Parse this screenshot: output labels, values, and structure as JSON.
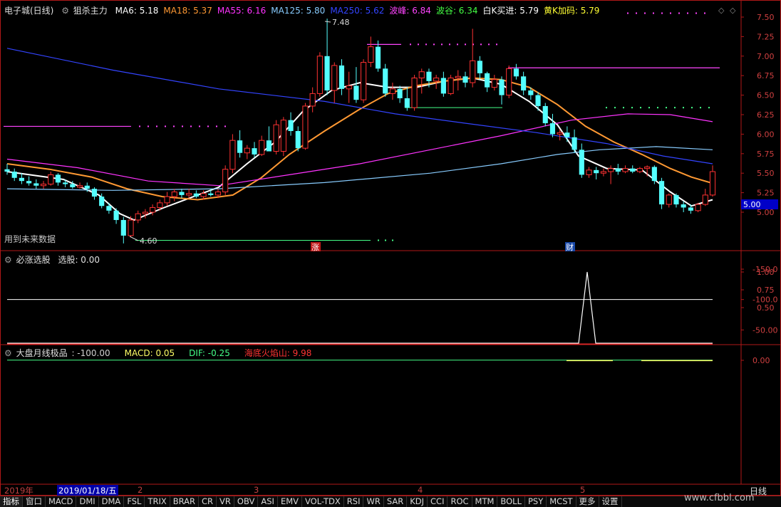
{
  "main_header": {
    "stock": "电子城(日线)",
    "indicator": "狙杀主力",
    "items": [
      {
        "label": "MA6: 5.18",
        "color": "#ffffff"
      },
      {
        "label": "MA18: 5.37",
        "color": "#ff9933"
      },
      {
        "label": "MA55: 6.16",
        "color": "#ff33ff"
      },
      {
        "label": "MA125: 5.80",
        "color": "#88ccff"
      },
      {
        "label": "MA250: 5.62",
        "color": "#3344ff"
      },
      {
        "label": "波峰: 6.84",
        "color": "#ff44ff"
      },
      {
        "label": "波谷: 6.34",
        "color": "#44ff44"
      },
      {
        "label": "白K买进: 5.79",
        "color": "#ffffff"
      },
      {
        "label": "黄K加码: 5.79",
        "color": "#ffff33"
      }
    ]
  },
  "panel2_header": {
    "title": "必涨选股",
    "value": "选股: 0.00"
  },
  "panel3_header": {
    "title": "大盘月线极品",
    "items": [
      {
        "label": ": -100.00",
        "color": "#d0d0d0"
      },
      {
        "label": "MACD: 0.05",
        "color": "#ffff66"
      },
      {
        "label": "DIF: -0.25",
        "color": "#44ff88"
      },
      {
        "label": "海底火焰山: 9.98",
        "color": "#ff3333"
      }
    ]
  },
  "annotations": {
    "future_data": "用到未来数据",
    "high_label": "7.48",
    "low_label": "4.60",
    "marker_zhang": "涨",
    "marker_cai": "财",
    "current_price": "5.00"
  },
  "date_bar": {
    "year": "2019年",
    "selected": "2019/01/18/五",
    "months": [
      "2",
      "3",
      "4",
      "5"
    ],
    "period": "日线"
  },
  "tabs": [
    "指标",
    "窗口",
    "MACD",
    "DMI",
    "DMA",
    "FSL",
    "TRIX",
    "BRAR",
    "CR",
    "VR",
    "OBV",
    "ASI",
    "EMV",
    "VOL-TDX",
    "RSI",
    "WR",
    "SAR",
    "KDJ",
    "CCI",
    "ROC",
    "MTM",
    "BOLL",
    "PSY",
    "MCST",
    "更多",
    "设置"
  ],
  "watermark": "www.cfbbl.com",
  "colors": {
    "up": "#ff3232",
    "down": "#54ffff",
    "frame": "#b01818"
  },
  "chart_data": [
    {
      "type": "candlestick",
      "title": "电子城(日线)",
      "ylim": [
        4.8,
        7.6
      ],
      "yticks": [
        7.5,
        7.25,
        7.0,
        6.75,
        6.5,
        6.25,
        6.0,
        5.75,
        5.5,
        5.25,
        5.0
      ],
      "ohlc": [
        [
          5.55,
          5.62,
          5.48,
          5.52
        ],
        [
          5.52,
          5.56,
          5.4,
          5.44
        ],
        [
          5.44,
          5.5,
          5.36,
          5.4
        ],
        [
          5.4,
          5.46,
          5.34,
          5.37
        ],
        [
          5.37,
          5.42,
          5.3,
          5.34
        ],
        [
          5.34,
          5.4,
          5.3,
          5.36
        ],
        [
          5.36,
          5.52,
          5.34,
          5.48
        ],
        [
          5.48,
          5.5,
          5.34,
          5.38
        ],
        [
          5.38,
          5.42,
          5.32,
          5.36
        ],
        [
          5.36,
          5.4,
          5.3,
          5.32
        ],
        [
          5.32,
          5.38,
          5.3,
          5.34
        ],
        [
          5.34,
          5.38,
          5.26,
          5.3
        ],
        [
          5.3,
          5.32,
          5.16,
          5.2
        ],
        [
          5.2,
          5.24,
          5.05,
          5.08
        ],
        [
          5.08,
          5.12,
          4.98,
          5.02
        ],
        [
          5.02,
          5.05,
          4.85,
          4.9
        ],
        [
          4.9,
          4.94,
          4.6,
          4.7
        ],
        [
          4.7,
          4.95,
          4.68,
          4.9
        ],
        [
          4.9,
          5.02,
          4.86,
          4.98
        ],
        [
          4.98,
          5.04,
          4.92,
          5.0
        ],
        [
          5.0,
          5.1,
          4.96,
          5.06
        ],
        [
          5.06,
          5.16,
          5.02,
          5.12
        ],
        [
          5.12,
          5.26,
          5.08,
          5.2
        ],
        [
          5.2,
          5.3,
          5.14,
          5.26
        ],
        [
          5.26,
          5.3,
          5.18,
          5.22
        ],
        [
          5.22,
          5.3,
          5.18,
          5.24
        ],
        [
          5.24,
          5.28,
          5.18,
          5.2
        ],
        [
          5.2,
          5.28,
          5.16,
          5.24
        ],
        [
          5.24,
          5.3,
          5.2,
          5.22
        ],
        [
          5.22,
          5.3,
          5.18,
          5.26
        ],
        [
          5.26,
          5.6,
          5.22,
          5.55
        ],
        [
          5.55,
          6.0,
          5.5,
          5.92
        ],
        [
          5.92,
          6.05,
          5.7,
          5.76
        ],
        [
          5.76,
          5.86,
          5.68,
          5.82
        ],
        [
          5.82,
          5.9,
          5.7,
          5.74
        ],
        [
          5.74,
          5.98,
          5.72,
          5.92
        ],
        [
          5.92,
          6.1,
          5.8,
          5.78
        ],
        [
          5.78,
          6.18,
          5.74,
          6.12
        ],
        [
          5.78,
          6.22,
          5.72,
          6.18
        ],
        [
          6.18,
          6.28,
          5.98,
          6.04
        ],
        [
          6.04,
          6.1,
          5.78,
          5.82
        ],
        [
          5.82,
          6.4,
          5.8,
          6.36
        ],
        [
          6.36,
          6.6,
          6.28,
          6.52
        ],
        [
          6.52,
          7.05,
          6.48,
          7.0
        ],
        [
          7.0,
          7.48,
          6.5,
          6.56
        ],
        [
          6.56,
          6.92,
          6.4,
          6.88
        ],
        [
          6.88,
          6.96,
          6.5,
          6.58
        ],
        [
          6.58,
          6.8,
          6.4,
          6.62
        ],
        [
          6.62,
          6.86,
          6.4,
          6.44
        ],
        [
          6.44,
          6.96,
          6.4,
          6.92
        ],
        [
          6.92,
          7.25,
          6.86,
          7.12
        ],
        [
          7.12,
          7.2,
          6.8,
          6.84
        ],
        [
          6.84,
          6.9,
          6.48,
          6.52
        ],
        [
          6.52,
          6.66,
          6.44,
          6.58
        ],
        [
          6.58,
          6.62,
          6.4,
          6.46
        ],
        [
          6.46,
          6.6,
          6.3,
          6.34
        ],
        [
          6.34,
          6.76,
          6.3,
          6.72
        ],
        [
          6.72,
          6.84,
          6.52,
          6.8
        ],
        [
          6.8,
          6.84,
          6.6,
          6.68
        ],
        [
          6.68,
          6.76,
          6.58,
          6.72
        ],
        [
          6.72,
          6.8,
          6.48,
          6.52
        ],
        [
          6.52,
          6.76,
          6.5,
          6.72
        ],
        [
          6.72,
          6.82,
          6.56,
          6.74
        ],
        [
          6.74,
          6.8,
          6.6,
          6.66
        ],
        [
          6.66,
          7.35,
          6.6,
          6.94
        ],
        [
          6.94,
          7.0,
          6.7,
          6.78
        ],
        [
          6.78,
          6.8,
          6.54,
          6.6
        ],
        [
          6.6,
          6.76,
          6.56,
          6.7
        ],
        [
          6.7,
          6.74,
          6.38,
          6.5
        ],
        [
          6.5,
          6.88,
          6.46,
          6.84
        ],
        [
          6.84,
          6.9,
          6.7,
          6.74
        ],
        [
          6.74,
          6.8,
          6.5,
          6.56
        ],
        [
          6.56,
          6.6,
          6.44,
          6.5
        ],
        [
          6.5,
          6.54,
          6.3,
          6.36
        ],
        [
          6.36,
          6.4,
          6.1,
          6.14
        ],
        [
          6.14,
          6.26,
          5.96,
          6.0
        ],
        [
          6.0,
          6.06,
          5.92,
          6.02
        ],
        [
          6.02,
          6.1,
          5.9,
          5.96
        ],
        [
          5.96,
          6.06,
          5.76,
          5.8
        ],
        [
          5.8,
          5.88,
          5.44,
          5.48
        ],
        [
          5.48,
          5.58,
          5.44,
          5.54
        ],
        [
          5.54,
          5.58,
          5.42,
          5.5
        ],
        [
          5.5,
          5.56,
          5.46,
          5.52
        ],
        [
          5.52,
          5.6,
          5.36,
          5.56
        ],
        [
          5.56,
          5.62,
          5.48,
          5.52
        ],
        [
          5.52,
          5.6,
          5.5,
          5.56
        ],
        [
          5.56,
          5.6,
          5.5,
          5.52
        ],
        [
          5.52,
          5.58,
          5.5,
          5.56
        ],
        [
          5.56,
          5.6,
          5.46,
          5.58
        ],
        [
          5.58,
          5.6,
          5.36,
          5.4
        ],
        [
          5.4,
          5.44,
          5.04,
          5.1
        ],
        [
          5.1,
          5.24,
          5.06,
          5.22
        ],
        [
          5.22,
          5.24,
          5.06,
          5.1
        ],
        [
          5.1,
          5.14,
          5.0,
          5.06
        ],
        [
          5.06,
          5.1,
          4.98,
          5.02
        ],
        [
          5.02,
          5.12,
          5.0,
          5.1
        ],
        [
          5.1,
          5.3,
          5.08,
          5.22
        ],
        [
          5.22,
          5.6,
          5.2,
          5.52
        ]
      ],
      "ma_series": [
        {
          "name": "MA6",
          "color": "#ffffff",
          "points": [
            [
              0,
              5.52
            ],
            [
              8,
              5.42
            ],
            [
              13,
              5.22
            ],
            [
              16,
              4.98
            ],
            [
              18,
              4.9
            ],
            [
              22,
              5.05
            ],
            [
              27,
              5.22
            ],
            [
              30,
              5.32
            ],
            [
              34,
              5.62
            ],
            [
              38,
              5.9
            ],
            [
              42,
              6.3
            ],
            [
              46,
              6.56
            ],
            [
              50,
              6.66
            ],
            [
              54,
              6.6
            ],
            [
              58,
              6.6
            ],
            [
              62,
              6.68
            ],
            [
              66,
              6.72
            ],
            [
              70,
              6.64
            ],
            [
              74,
              6.42
            ],
            [
              78,
              6.12
            ],
            [
              81,
              5.72
            ],
            [
              85,
              5.56
            ],
            [
              90,
              5.54
            ],
            [
              94,
              5.26
            ],
            [
              97,
              5.08
            ],
            [
              100,
              5.16
            ]
          ]
        },
        {
          "name": "MA18",
          "color": "#ff9933",
          "points": [
            [
              0,
              5.62
            ],
            [
              6,
              5.55
            ],
            [
              12,
              5.45
            ],
            [
              17,
              5.3
            ],
            [
              22,
              5.2
            ],
            [
              27,
              5.16
            ],
            [
              32,
              5.22
            ],
            [
              36,
              5.44
            ],
            [
              40,
              5.74
            ],
            [
              45,
              6.04
            ],
            [
              50,
              6.32
            ],
            [
              54,
              6.52
            ],
            [
              58,
              6.62
            ],
            [
              62,
              6.68
            ],
            [
              66,
              6.72
            ],
            [
              70,
              6.7
            ],
            [
              74,
              6.6
            ],
            [
              78,
              6.38
            ],
            [
              82,
              6.1
            ],
            [
              86,
              5.9
            ],
            [
              90,
              5.74
            ],
            [
              94,
              5.56
            ],
            [
              97,
              5.45
            ],
            [
              100,
              5.37
            ]
          ]
        },
        {
          "name": "MA55",
          "color": "#ff33ff",
          "points": [
            [
              0,
              5.68
            ],
            [
              10,
              5.57
            ],
            [
              20,
              5.4
            ],
            [
              30,
              5.34
            ],
            [
              40,
              5.48
            ],
            [
              50,
              5.62
            ],
            [
              60,
              5.8
            ],
            [
              70,
              5.98
            ],
            [
              80,
              6.18
            ],
            [
              88,
              6.26
            ],
            [
              94,
              6.25
            ],
            [
              100,
              6.16
            ]
          ]
        },
        {
          "name": "MA125",
          "color": "#88ccff",
          "points": [
            [
              0,
              5.3
            ],
            [
              15,
              5.28
            ],
            [
              30,
              5.3
            ],
            [
              45,
              5.38
            ],
            [
              60,
              5.5
            ],
            [
              70,
              5.62
            ],
            [
              78,
              5.74
            ],
            [
              84,
              5.8
            ],
            [
              92,
              5.84
            ],
            [
              100,
              5.8
            ]
          ]
        },
        {
          "name": "MA250",
          "color": "#3344ff",
          "points": [
            [
              0,
              7.1
            ],
            [
              15,
              6.82
            ],
            [
              30,
              6.58
            ],
            [
              45,
              6.42
            ],
            [
              55,
              6.26
            ],
            [
              65,
              6.14
            ],
            [
              75,
              6.02
            ],
            [
              85,
              5.88
            ],
            [
              93,
              5.72
            ],
            [
              100,
              5.62
            ]
          ]
        }
      ]
    },
    {
      "type": "line",
      "title": "必涨选股",
      "ylim": [
        0,
        1.2
      ],
      "yticks": [
        1.0,
        0.75,
        0.5
      ],
      "points": [
        [
          0,
          0
        ],
        [
          80,
          0
        ],
        [
          81,
          1
        ],
        [
          82,
          0
        ],
        [
          100,
          0
        ]
      ]
    },
    {
      "type": "line",
      "title": "大盘月线极品",
      "ylim": [
        -180,
        10
      ],
      "yticks": [
        0.0,
        -50.0,
        -100.0,
        -150.0
      ],
      "series": [
        {
          "color": "#ffffff",
          "points": [
            [
              0,
              -100
            ],
            [
              100,
              -100
            ]
          ]
        },
        {
          "color": "#44ff88",
          "points": [
            [
              0,
              -0.25
            ],
            [
              100,
              -0.25
            ]
          ]
        }
      ]
    }
  ]
}
